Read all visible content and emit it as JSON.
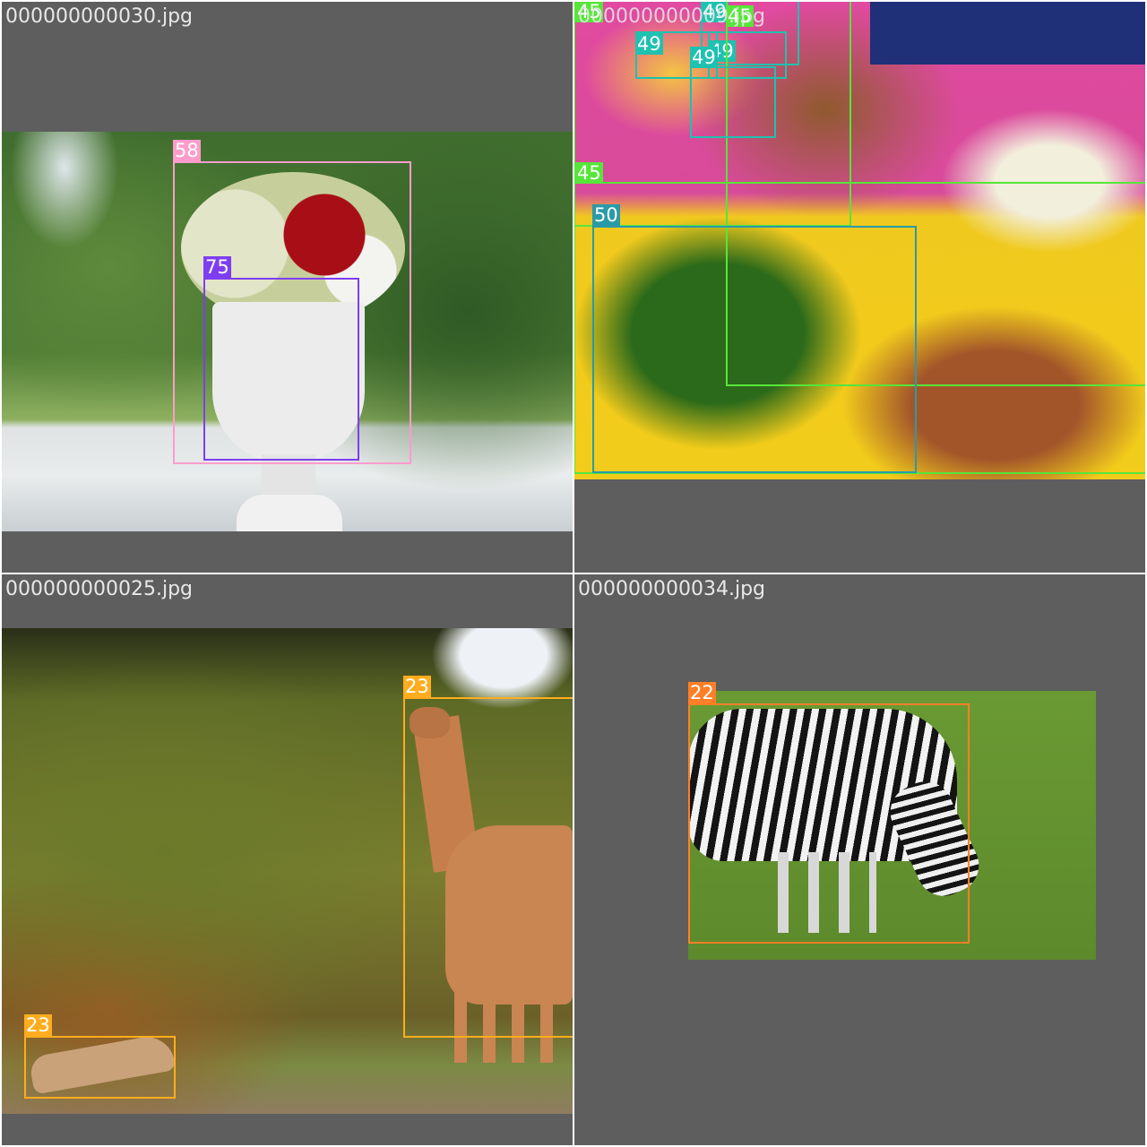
{
  "tiles": [
    {
      "filename": "000000000030.jpg",
      "boxes": [
        {
          "label": "58",
          "color": "#ff9ccc"
        },
        {
          "label": "75",
          "color": "#7e3ef0"
        }
      ]
    },
    {
      "filename": "000000000009.jpg",
      "boxes": [
        {
          "label": "45",
          "color": "#57e53a"
        },
        {
          "label": "49",
          "color": "#1fc1b0"
        },
        {
          "label": "49",
          "color": "#1fc1b0"
        },
        {
          "label": "49",
          "color": "#1fc1b0"
        },
        {
          "label": "45",
          "color": "#57e53a"
        },
        {
          "label": "49",
          "color": "#1fc1b0"
        },
        {
          "label": "45",
          "color": "#57e53a"
        },
        {
          "label": "50",
          "color": "#2a9aa8"
        }
      ]
    },
    {
      "filename": "000000000025.jpg",
      "boxes": [
        {
          "label": "23",
          "color": "#ffad1e"
        },
        {
          "label": "23",
          "color": "#ffad1e"
        }
      ]
    },
    {
      "filename": "000000000034.jpg",
      "boxes": [
        {
          "label": "22",
          "color": "#ff7f27"
        }
      ]
    }
  ]
}
